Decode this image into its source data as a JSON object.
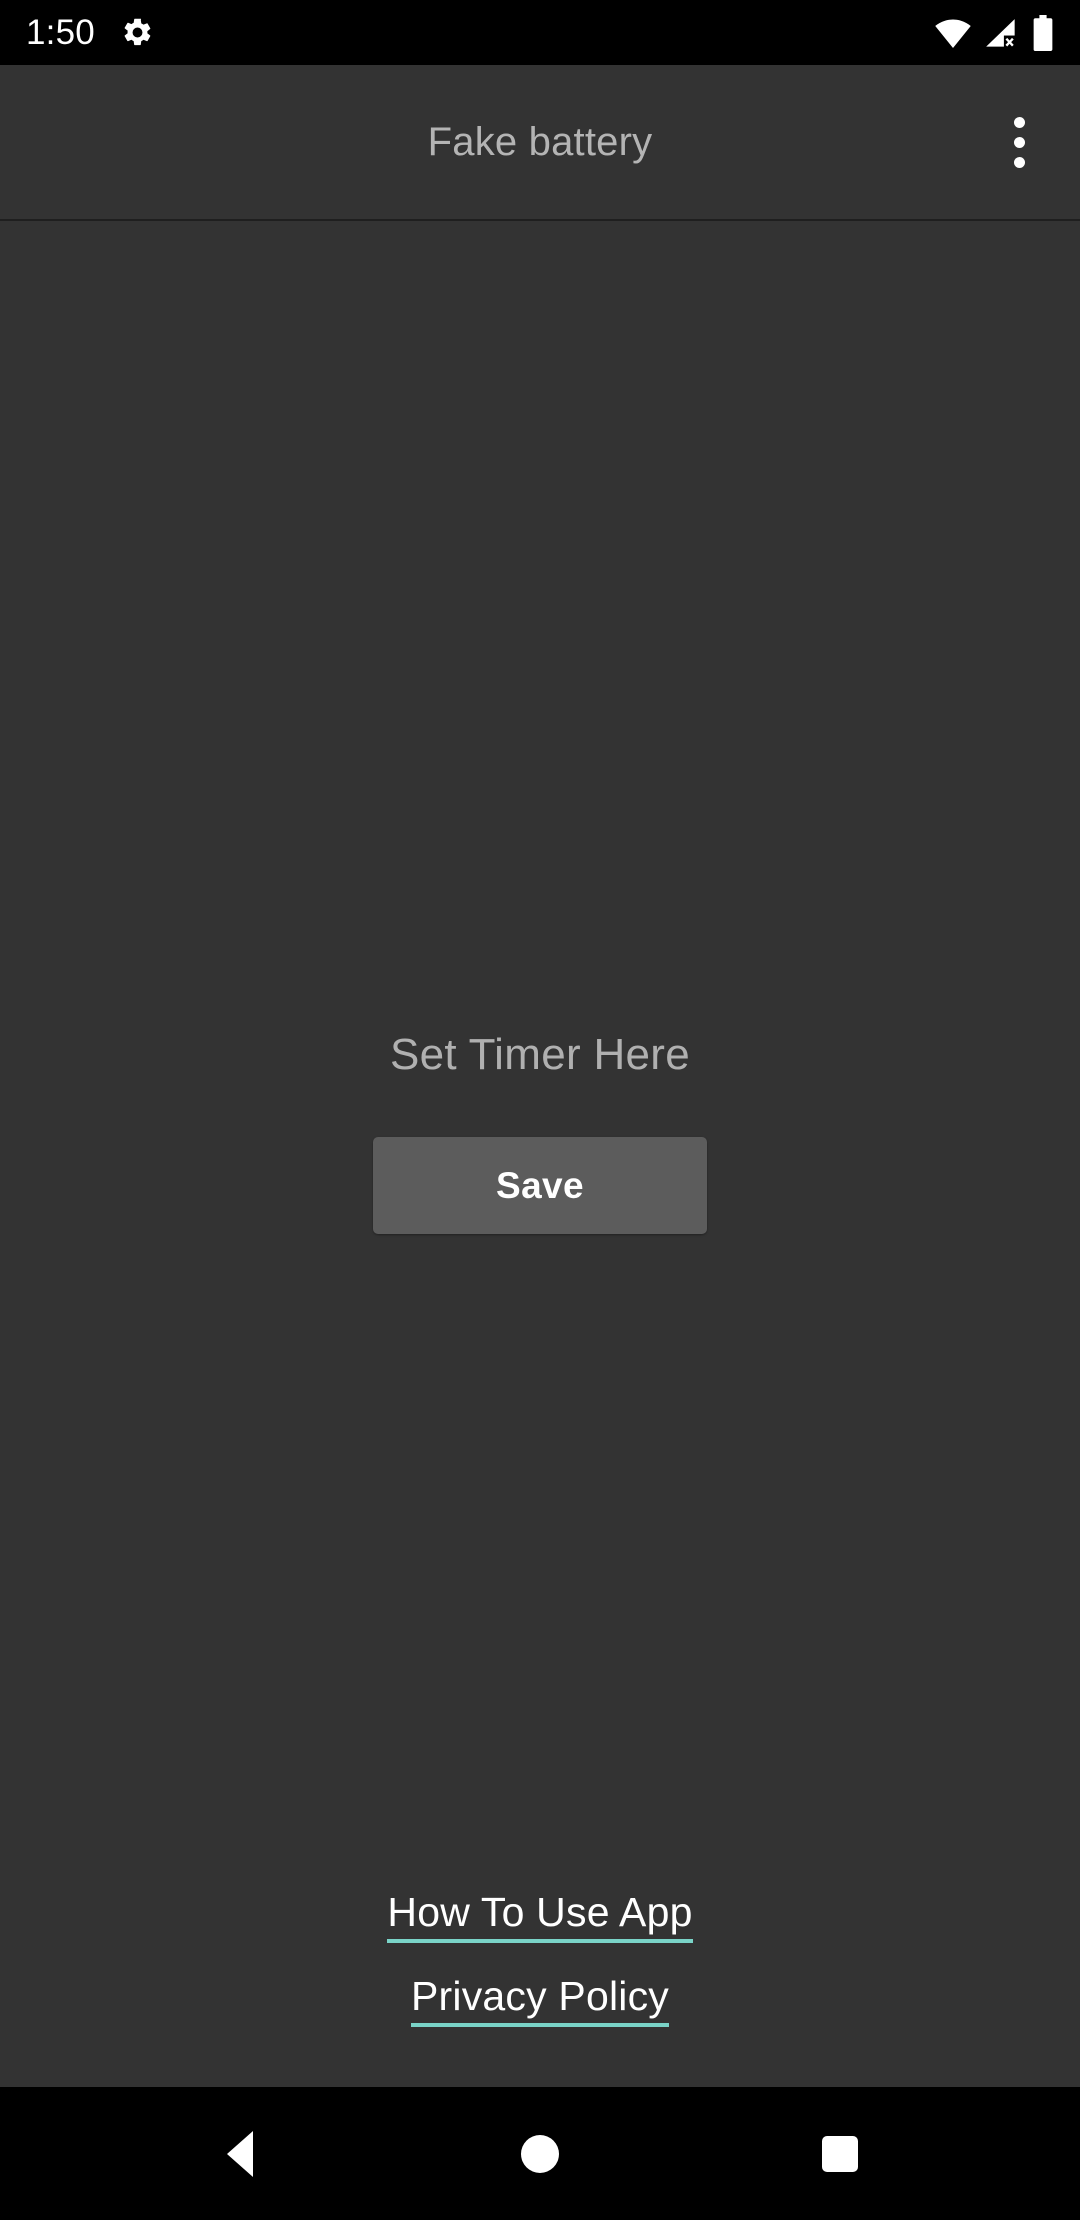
{
  "status_bar": {
    "time": "1:50",
    "icons": {
      "settings": "gear-icon",
      "wifi": "wifi-icon",
      "cellular": "signal-no-sim-icon",
      "battery": "battery-full-icon"
    }
  },
  "app_bar": {
    "title": "Fake battery",
    "overflow_menu": "more-options-icon"
  },
  "main": {
    "timer_label": "Set Timer Here",
    "save_label": "Save"
  },
  "footer": {
    "how_to_use_label": "How To Use App",
    "privacy_policy_label": "Privacy Policy",
    "link_underline_color": "#7ad4c8"
  },
  "nav_bar": {
    "back": "back-triangle-icon",
    "home": "home-circle-icon",
    "recents": "recents-square-icon"
  },
  "colors": {
    "app_bar_bg": "#333333",
    "content_bg": "#333333",
    "status_bar_bg": "#000000",
    "nav_bar_bg": "#000000",
    "save_button_bg": "#5c5c5c",
    "title_text": "#b4b4b4",
    "body_text": "#b0b0b0",
    "link_text": "#ffffff"
  }
}
